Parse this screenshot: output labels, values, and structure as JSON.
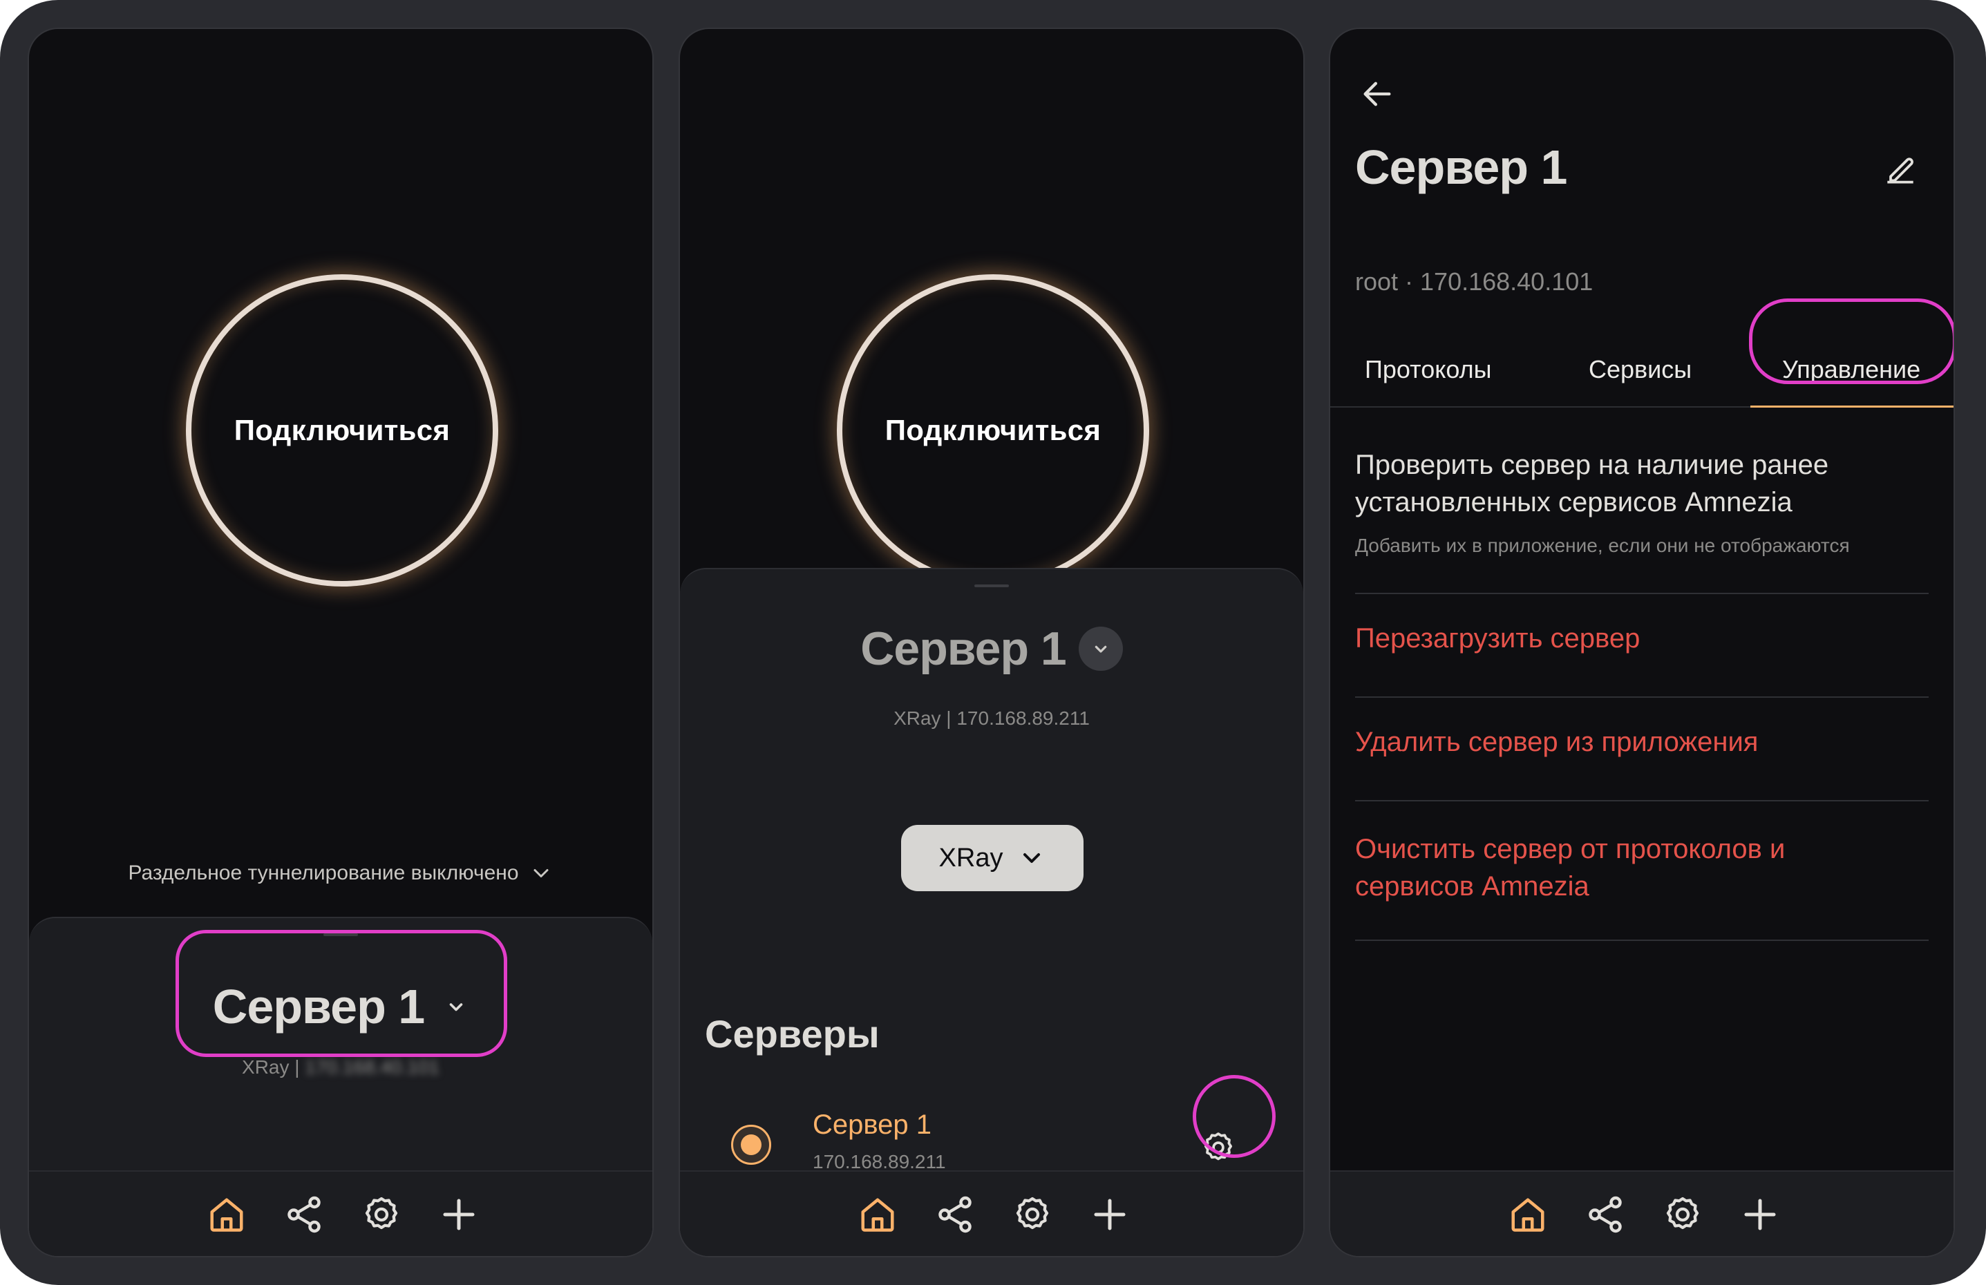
{
  "colors": {
    "accent": "#fbb26a",
    "danger": "#e5534b",
    "highlight": "#e13ec8",
    "background": "#0e0e11",
    "sheet": "#1c1d21"
  },
  "screen1": {
    "connect_label": "Подключиться",
    "split_tunneling": "Раздельное туннелирование выключено",
    "server_title": "Сервер 1",
    "server_subtitle": "XRay |",
    "server_subtitle_blurred": "170.168.40.101"
  },
  "screen2": {
    "connect_label": "Подключиться",
    "server_title": "Сервер 1",
    "server_subtitle": "XRay | 170.168.89.211",
    "protocol_select": "XRay",
    "servers_heading": "Серверы",
    "servers": [
      {
        "name": "Сервер 1",
        "address": "170.168.89.211",
        "selected": true
      }
    ]
  },
  "screen3": {
    "title": "Сервер 1",
    "subtitle": "root · 170.168.40.101",
    "tabs": [
      {
        "label": "Протоколы",
        "active": false
      },
      {
        "label": "Сервисы",
        "active": false
      },
      {
        "label": "Управление",
        "active": true
      }
    ],
    "check_title": "Проверить сервер на наличие ранее установленных сервисов Amnezia",
    "check_subtitle": "Добавить их в приложение, если они не отображаются",
    "actions": [
      {
        "label": "Перезагрузить сервер"
      },
      {
        "label": "Удалить сервер из приложения"
      },
      {
        "label": "Очистить сервер от протоколов и сервисов Amnezia"
      }
    ]
  },
  "nav": {
    "items": [
      {
        "icon": "home-icon",
        "active": true
      },
      {
        "icon": "share-icon",
        "active": false
      },
      {
        "icon": "gear-icon",
        "active": false
      },
      {
        "icon": "plus-icon",
        "active": false
      }
    ]
  }
}
